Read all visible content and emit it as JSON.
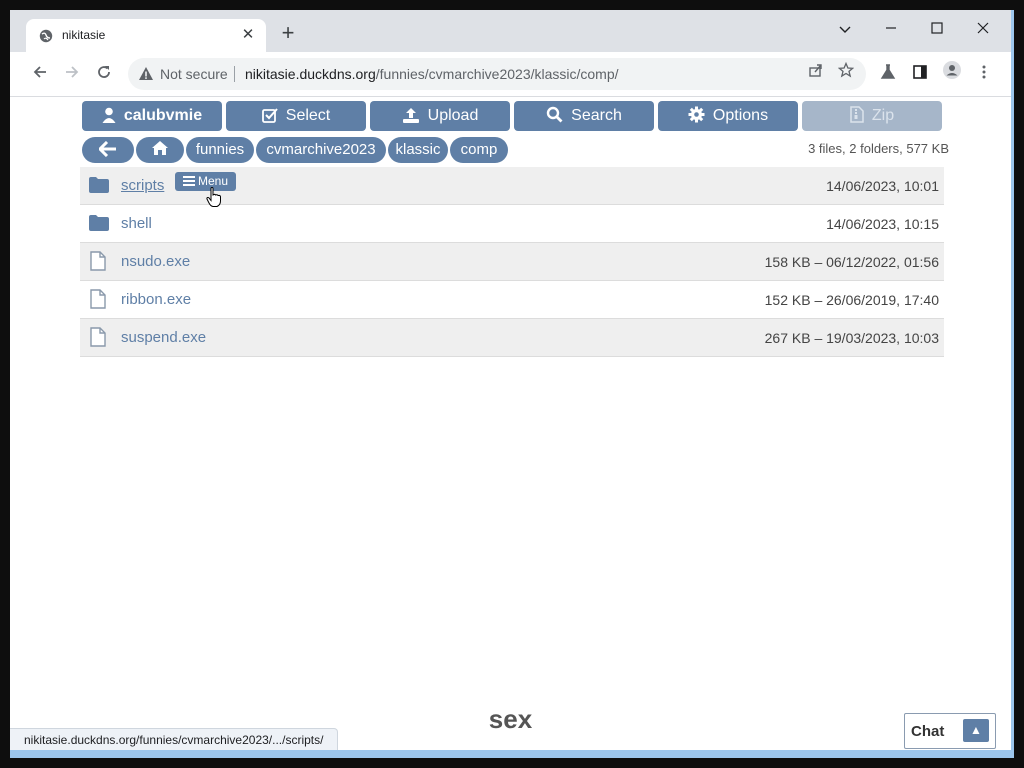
{
  "browser": {
    "tab_title": "nikitasie",
    "tab_close": "✕",
    "new_tab": "+",
    "security_label": "Not secure",
    "url_host": "nikitasie.duckdns.org",
    "url_path": "/funnies/cvmarchive2023/klassic/comp/",
    "status_url": "nikitasie.duckdns.org/funnies/cvmarchive2023/.../scripts/"
  },
  "toolbar": {
    "user_label": "calubvmie",
    "select_label": "Select",
    "upload_label": "Upload",
    "search_label": "Search",
    "options_label": "Options",
    "zip_label": "Zip"
  },
  "breadcrumbs": [
    "funnies",
    "cvmarchive2023",
    "klassic",
    "comp"
  ],
  "summary": "3 files, 2 folders, 577 KB",
  "menu_badge": "Menu",
  "entries": [
    {
      "name": "scripts",
      "type": "folder",
      "meta": "14/06/2023, 10:01"
    },
    {
      "name": "shell",
      "type": "folder",
      "meta": "14/06/2023, 10:15"
    },
    {
      "name": "nsudo.exe",
      "type": "file",
      "meta": "158 KB – 06/12/2022, 01:56"
    },
    {
      "name": "ribbon.exe",
      "type": "file",
      "meta": "152 KB – 26/06/2019, 17:40"
    },
    {
      "name": "suspend.exe",
      "type": "file",
      "meta": "267 KB – 19/03/2023, 10:03"
    }
  ],
  "footer_text": "sex",
  "chat": {
    "label": "Chat",
    "toggle": "▲"
  },
  "colors": {
    "accent": "#5f7fa6",
    "accent_disabled": "#a6b6c9"
  }
}
